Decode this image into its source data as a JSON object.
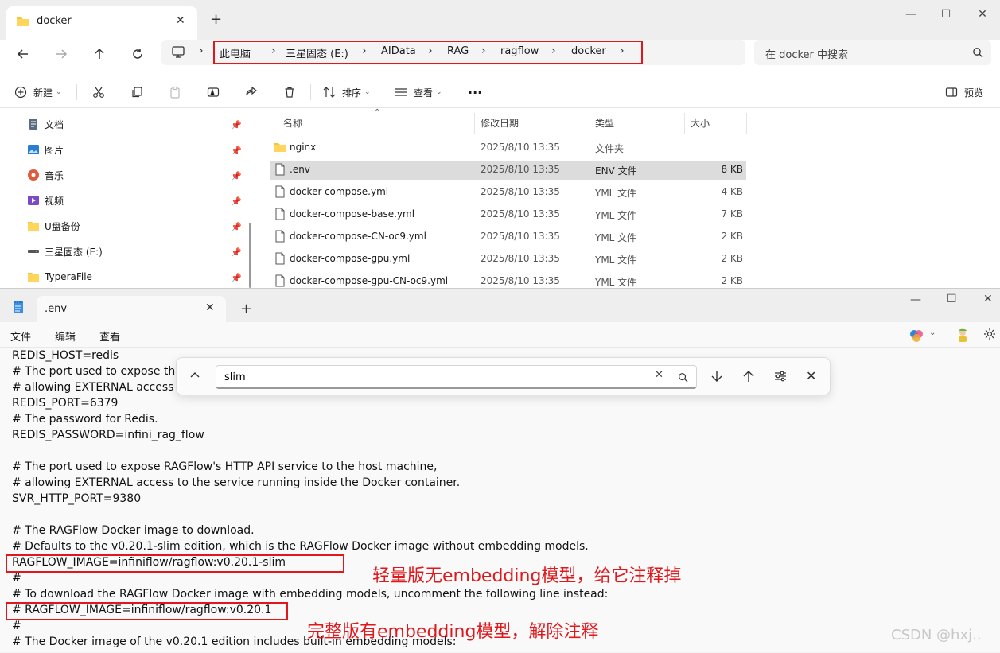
{
  "explorer": {
    "tab_title": "docker",
    "new_tab": "+",
    "breadcrumb": [
      "此电脑",
      "三星固态 (E:)",
      "AIData",
      "RAG",
      "ragflow",
      "docker"
    ],
    "search_placeholder": "在 docker 中搜索",
    "toolbar": {
      "new_label": "新建",
      "sort_label": "排序",
      "view_label": "查看",
      "more_label": "···",
      "preview_label": "预览"
    },
    "nav_items": [
      {
        "label": "文档",
        "icon": "document-icon"
      },
      {
        "label": "图片",
        "icon": "pictures-icon"
      },
      {
        "label": "音乐",
        "icon": "music-icon"
      },
      {
        "label": "视频",
        "icon": "video-icon"
      },
      {
        "label": "U盘备份",
        "icon": "folder-icon"
      },
      {
        "label": "三星固态 (E:)",
        "icon": "drive-icon"
      },
      {
        "label": "TyperaFile",
        "icon": "folder-icon"
      }
    ],
    "columns": {
      "name": "名称",
      "date": "修改日期",
      "type": "类型",
      "size": "大小"
    },
    "files": [
      {
        "name": "nginx",
        "date": "2025/8/10 13:35",
        "type": "文件夹",
        "size": "",
        "icon": "folder-icon"
      },
      {
        "name": ".env",
        "date": "2025/8/10 13:35",
        "type": "ENV 文件",
        "size": "8 KB",
        "icon": "file-icon"
      },
      {
        "name": "docker-compose.yml",
        "date": "2025/8/10 13:35",
        "type": "YML 文件",
        "size": "4 KB",
        "icon": "file-icon"
      },
      {
        "name": "docker-compose-base.yml",
        "date": "2025/8/10 13:35",
        "type": "YML 文件",
        "size": "7 KB",
        "icon": "file-icon"
      },
      {
        "name": "docker-compose-CN-oc9.yml",
        "date": "2025/8/10 13:35",
        "type": "YML 文件",
        "size": "2 KB",
        "icon": "file-icon"
      },
      {
        "name": "docker-compose-gpu.yml",
        "date": "2025/8/10 13:35",
        "type": "YML 文件",
        "size": "2 KB",
        "icon": "file-icon"
      },
      {
        "name": "docker-compose-gpu-CN-oc9.yml",
        "date": "2025/8/10 13:35",
        "type": "YML 文件",
        "size": "2 KB",
        "icon": "file-icon"
      }
    ],
    "selected_file": ".env"
  },
  "notepad": {
    "tab_title": ".env",
    "new_tab": "+",
    "menu": [
      "文件",
      "编辑",
      "查看"
    ],
    "find_query": "slim",
    "lines": [
      "REDIS_HOST=redis",
      "# The port used to expose th",
      "# allowing EXTERNAL access",
      "REDIS_PORT=6379",
      "# The password for Redis.",
      "REDIS_PASSWORD=infini_rag_flow",
      "",
      "# The port used to expose RAGFlow's HTTP API service to the host machine,",
      "# allowing EXTERNAL access to the service running inside the Docker container.",
      "SVR_HTTP_PORT=9380",
      "",
      "# The RAGFlow Docker image to download.",
      "# Defaults to the v0.20.1-slim edition, which is the RAGFlow Docker image without embedding models.",
      "RAGFLOW_IMAGE=infiniflow/ragflow:v0.20.1-slim",
      "#",
      "# To download the RAGFlow Docker image with embedding models, uncomment the following line instead:",
      "# RAGFLOW_IMAGE=infiniflow/ragflow:v0.20.1",
      "#",
      "# The Docker image of the v0.20.1 edition includes built-in embedding models:"
    ]
  },
  "annotations": {
    "slim_note": "轻量版无embedding模型，给它注释掉",
    "full_note": "完整版有embedding模型，解除注释",
    "color": "#e0181b"
  },
  "watermark": "CSDN @hxj.."
}
